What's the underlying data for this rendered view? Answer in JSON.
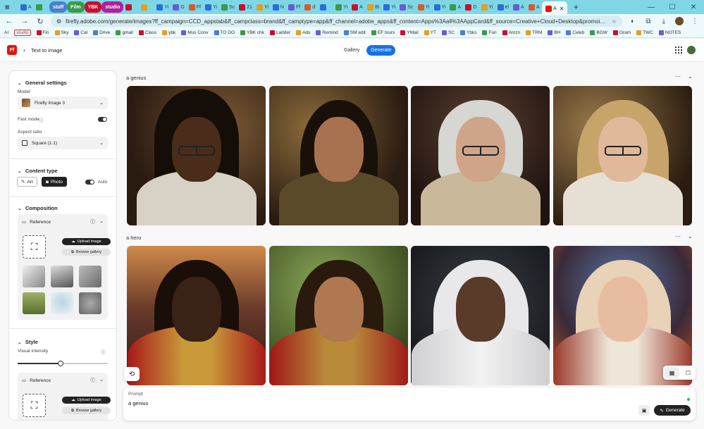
{
  "browser": {
    "tabs": [
      "A",
      "",
      "",
      "",
      "Yi",
      "G",
      "Ff",
      "Yi",
      "Sc",
      "21",
      "Yi",
      "N",
      "Ff",
      "d",
      "",
      "Yi",
      "A",
      "Bi",
      "Yi",
      "Sc",
      "Yi",
      "Yi",
      "A",
      "D",
      "Yi",
      "el",
      "A",
      "A"
    ],
    "pill_tabs": [
      {
        "label": "stuff",
        "color": "#4a7fd0"
      },
      {
        "label": "Film",
        "color": "#3a9a4a"
      },
      {
        "label": "YBK",
        "color": "#c8102e"
      },
      {
        "label": "studio",
        "color": "#b0209a"
      }
    ],
    "active_tab_label": "A",
    "new_tab": "+",
    "url": "firefly.adobe.com/generate/images?ff_campaign=CCD_appstab&ff_campclass=brand&ff_camptype=app&ff_channel=adobe_apps&ff_content=Apps%3Aall%3AAppCard&ff_source=Creative+Cloud+Desktop&promoid=DZTGZSX7&x-product=Creative+Cloud..."
  },
  "bookmarks": [
    {
      "label": "AI"
    },
    {
      "label": "studio",
      "boxed": true
    },
    {
      "label": "Fin"
    },
    {
      "label": "Sky"
    },
    {
      "label": "Cal"
    },
    {
      "label": "Drive"
    },
    {
      "label": "gmail"
    },
    {
      "label": "Class"
    },
    {
      "label": "ybk"
    },
    {
      "label": "Mus Conv"
    },
    {
      "label": "TO DO"
    },
    {
      "label": "YBK chk"
    },
    {
      "label": "Ladder"
    },
    {
      "label": "Ads"
    },
    {
      "label": "Remind"
    },
    {
      "label": "SM edit"
    },
    {
      "label": "EF tours"
    },
    {
      "label": "YMail"
    },
    {
      "label": "YT"
    },
    {
      "label": "SC"
    },
    {
      "label": "Ybks"
    },
    {
      "label": "Fun"
    },
    {
      "label": "Amzn"
    },
    {
      "label": "TRM"
    },
    {
      "label": "BH"
    },
    {
      "label": "Celeb"
    },
    {
      "label": "BGW"
    },
    {
      "label": "Gram"
    },
    {
      "label": "TWC"
    },
    {
      "label": "NOTES"
    }
  ],
  "app": {
    "logo": "Ff",
    "breadcrumb": "Text to image",
    "top_tabs": {
      "gallery": "Gallery",
      "generate": "Generate"
    },
    "accent": "#1473e6"
  },
  "sidebar": {
    "general_title": "General settings",
    "model_label": "Model",
    "model_value": "Firefly Image 3",
    "fast_mode_label": "Fast mode",
    "aspect_label": "Aspect ratio",
    "aspect_value": "Square (1:1)",
    "content_type_title": "Content type",
    "art_label": "Art",
    "photo_label": "Photo",
    "auto_label": "Auto",
    "composition_title": "Composition",
    "reference_label": "Reference",
    "upload_label": "Upload image",
    "browse_label": "Browse gallery",
    "style_title": "Style",
    "visual_intensity_label": "Visual intensity",
    "visual_intensity_value": 0.48
  },
  "gallery": {
    "rows": [
      {
        "label": "a genius"
      },
      {
        "label": "a hero"
      }
    ]
  },
  "prompt": {
    "label": "Prompt",
    "value": "a genius",
    "generate_label": "Generate"
  }
}
